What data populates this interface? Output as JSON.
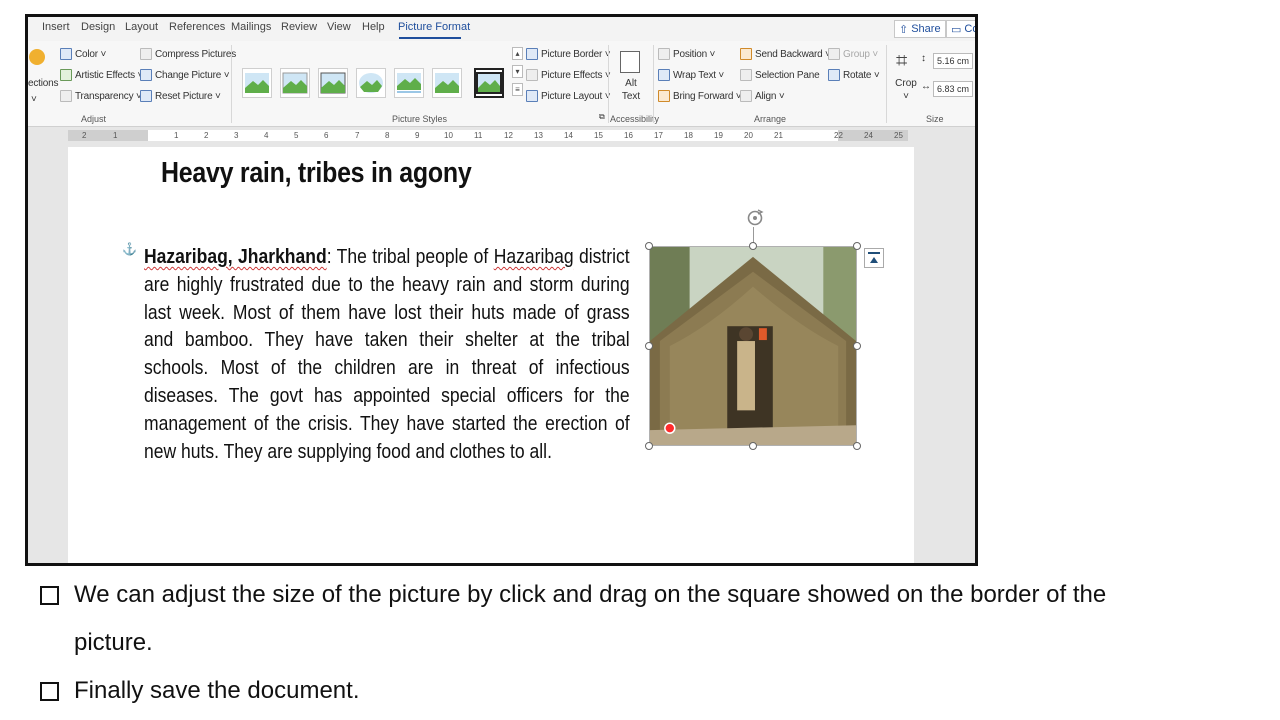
{
  "tabs": {
    "items": [
      "Insert",
      "Design",
      "Layout",
      "References",
      "Mailings",
      "Review",
      "View",
      "Help",
      "Picture Format"
    ],
    "active": "Picture Format",
    "share": "Share",
    "comments": "Cor"
  },
  "ribbon": {
    "adjust": {
      "partial_left": "ections",
      "color": "Color ˅",
      "artistic_effects": "Artistic Effects ˅",
      "transparency": "Transparency ˅",
      "compress": "Compress Pictures",
      "change_picture": "Change Picture ˅",
      "reset_picture": "Reset Picture ˅",
      "label": "Adjust"
    },
    "picture_styles": {
      "border": "Picture Border ˅",
      "effects": "Picture Effects ˅",
      "layout": "Picture Layout ˅",
      "label": "Picture Styles"
    },
    "accessibility": {
      "alt_line1": "Alt",
      "alt_line2": "Text",
      "label": "Accessibility"
    },
    "arrange": {
      "position": "Position ˅",
      "wrap_text": "Wrap Text ˅",
      "bring_forward": "Bring Forward ˅",
      "send_backward": "Send Backward ˅",
      "selection_pane": "Selection Pane",
      "align": "Align ˅",
      "group": "Group ˅",
      "rotate": "Rotate ˅",
      "label": "Arrange"
    },
    "size": {
      "crop": "Crop",
      "height": "5.16 cm",
      "width": "6.83 cm",
      "label": "Size"
    }
  },
  "ruler": {
    "numbers": [
      "2",
      "1",
      "1",
      "2",
      "3",
      "4",
      "5",
      "6",
      "7",
      "8",
      "9",
      "10",
      "11",
      "12",
      "13",
      "14",
      "15",
      "16",
      "17",
      "18",
      "19",
      "20",
      "21",
      "22",
      "24",
      "25"
    ]
  },
  "document": {
    "headline": "Heavy rain, tribes in agony",
    "dateline": "Hazaribag, Jharkhand",
    "body_1": ": The tribal people of ",
    "body_word": "Hazaribag",
    "body_2": " district are highly frustrated due to the heavy rain and storm during last week. Most of them have lost their huts made of grass and bamboo. They have taken their shelter at the tribal schools. Most of the children are in threat of infectious diseases. The govt has appointed special officers for the management of the crisis. They have started the erection of new huts. They are supplying food and clothes to all."
  },
  "slide": {
    "bullets": [
      [
        "We can adjust the size of the picture by click and drag on the square showed on the border of the",
        "picture."
      ],
      [
        "Finally save the document."
      ]
    ]
  }
}
